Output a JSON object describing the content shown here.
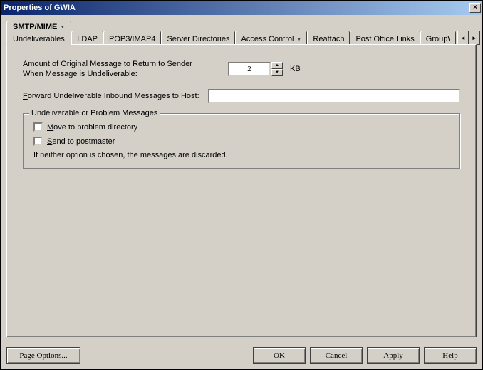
{
  "window": {
    "title": "Properties of GWIA",
    "close": "×"
  },
  "tabs": {
    "active": {
      "label": "SMTP/MIME",
      "sub": "Undeliverables"
    },
    "items": [
      "LDAP",
      "POP3/IMAP4",
      "Server Directories",
      "Access Control",
      "Reattach",
      "Post Office Links",
      "GroupWise"
    ],
    "dropdowns": [
      0,
      3
    ]
  },
  "content": {
    "amount_label_l1": "Amount of Original Message to Return to Sender",
    "amount_label_l2": "When Message is Undeliverable:",
    "amount_value": "2",
    "amount_unit": "KB",
    "forward_label": "Forward Undeliverable Inbound Messages to Host:",
    "forward_value": "",
    "group_title": "Undeliverable or Problem Messages",
    "opt_move": "Move to problem directory",
    "opt_send": "Send to postmaster",
    "note": "If neither option is chosen, the messages are discarded."
  },
  "buttons": {
    "page_options": "Page Options...",
    "ok": "OK",
    "cancel": "Cancel",
    "apply": "Apply",
    "help": "Help"
  }
}
